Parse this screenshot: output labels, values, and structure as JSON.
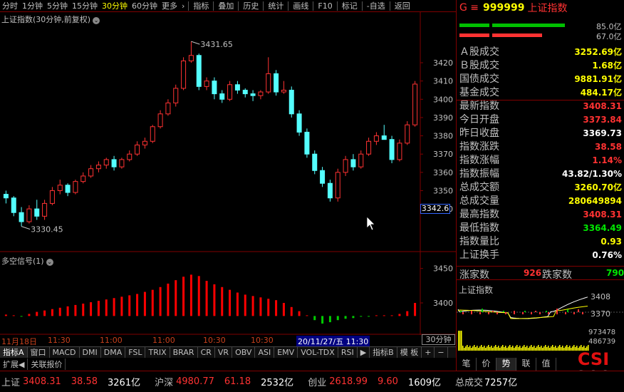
{
  "toolbar": {
    "timeframes": [
      "分时",
      "1分钟",
      "5分钟",
      "15分钟",
      "30分钟",
      "60分钟",
      "更多"
    ],
    "selected_timeframe": "30分钟",
    "buttons": [
      "指标",
      "叠加",
      "历史",
      "统计",
      "画线",
      "F10",
      "标记",
      "-自选",
      "返回"
    ]
  },
  "chart": {
    "title": "上证指数(30分钟,前复权)",
    "high_label": "3431.65",
    "low_label": "3330.45",
    "price_ticks": [
      "3420",
      "3410",
      "3400",
      "3390",
      "3380",
      "3370",
      "3360",
      "3350",
      "3340"
    ],
    "cursor_price": "3342.6",
    "sub_title": "多空信号(1)",
    "sub_ticks": [
      "3450",
      "3400"
    ],
    "time_labels": [
      "11月18日",
      "11:30",
      "11:00",
      "11:00",
      "10:30",
      "10:30"
    ],
    "time_cursor": "20/11/27/五 11:30",
    "period_label": "30分钟"
  },
  "indicator_tabs": [
    "指标A",
    "窗口",
    "MACD",
    "DMI",
    "DMA",
    "FSL",
    "TRIX",
    "BRAR",
    "CR",
    "VR",
    "OBV",
    "ASI",
    "EMV",
    "VOL-TDX",
    "RSI",
    "▶",
    "指标B",
    "模 板",
    "+",
    "−"
  ],
  "ext_tabs": [
    "扩展◀",
    "关联报价"
  ],
  "chart_data": {
    "type": "candlestick",
    "title": "上证指数(30分钟,前复权)",
    "ylim": [
      3326,
      3436
    ],
    "ohlc_approx": [
      [
        3348,
        3350,
        3343,
        3346
      ],
      [
        3346,
        3347,
        3336,
        3338
      ],
      [
        3338,
        3341,
        3330.45,
        3333
      ],
      [
        3333,
        3342,
        3332,
        3340
      ],
      [
        3340,
        3345,
        3334,
        3336
      ],
      [
        3336,
        3345,
        3334,
        3343
      ],
      [
        3343,
        3352,
        3342,
        3350
      ],
      [
        3350,
        3356,
        3348,
        3353
      ],
      [
        3353,
        3354,
        3347,
        3349
      ],
      [
        3349,
        3356,
        3348,
        3355
      ],
      [
        3355,
        3360,
        3354,
        3358
      ],
      [
        3358,
        3364,
        3357,
        3362
      ],
      [
        3362,
        3366,
        3360,
        3364
      ],
      [
        3364,
        3368,
        3362,
        3367
      ],
      [
        3367,
        3369,
        3361,
        3363
      ],
      [
        3363,
        3368,
        3362,
        3367
      ],
      [
        3367,
        3372,
        3366,
        3370
      ],
      [
        3370,
        3377,
        3369,
        3375
      ],
      [
        3375,
        3379,
        3373,
        3377
      ],
      [
        3377,
        3386,
        3376,
        3385
      ],
      [
        3385,
        3394,
        3384,
        3392
      ],
      [
        3392,
        3400,
        3391,
        3398
      ],
      [
        3398,
        3408,
        3396,
        3406
      ],
      [
        3406,
        3423,
        3405,
        3421
      ],
      [
        3421,
        3431.65,
        3420,
        3424
      ],
      [
        3424,
        3425,
        3405,
        3407
      ],
      [
        3407,
        3412,
        3405,
        3410
      ],
      [
        3410,
        3412,
        3400,
        3403
      ],
      [
        3403,
        3405,
        3398,
        3400
      ],
      [
        3400,
        3410,
        3399,
        3408
      ],
      [
        3408,
        3410,
        3403,
        3405
      ],
      [
        3405,
        3406,
        3401,
        3403
      ],
      [
        3403,
        3405,
        3399,
        3402
      ],
      [
        3402,
        3405,
        3400,
        3404
      ],
      [
        3404,
        3423,
        3403,
        3414
      ],
      [
        3414,
        3416,
        3402,
        3404
      ],
      [
        3404,
        3410,
        3403,
        3405
      ],
      [
        3405,
        3407,
        3390,
        3392
      ],
      [
        3392,
        3394,
        3380,
        3382
      ],
      [
        3382,
        3384,
        3368,
        3370
      ],
      [
        3370,
        3372,
        3359,
        3361
      ],
      [
        3361,
        3363,
        3352,
        3354
      ],
      [
        3354,
        3356,
        3344,
        3346
      ],
      [
        3346,
        3362,
        3344,
        3360
      ],
      [
        3360,
        3369,
        3358,
        3367
      ],
      [
        3367,
        3370,
        3361,
        3363
      ],
      [
        3363,
        3372,
        3362,
        3370
      ],
      [
        3370,
        3379,
        3369,
        3377
      ],
      [
        3377,
        3382,
        3375,
        3380
      ],
      [
        3380,
        3386,
        3378,
        3378
      ],
      [
        3378,
        3380,
        3365,
        3367
      ],
      [
        3367,
        3378,
        3366,
        3376
      ],
      [
        3376,
        3388,
        3375,
        3386
      ],
      [
        3386,
        3410,
        3385,
        3408.31
      ]
    ],
    "signal": {
      "name": "多空信号(1)",
      "ylim": [
        3370,
        3460
      ],
      "values": [
        3383,
        3382,
        3381,
        3384,
        3387,
        3389,
        3391,
        3393,
        3395,
        3397,
        3399,
        3401,
        3403,
        3405,
        3407,
        3409,
        3411,
        3413,
        3416,
        3419,
        3423,
        3428,
        3433,
        3438,
        3441,
        3439,
        3432,
        3427,
        3423,
        3419,
        3415,
        3412,
        3410,
        3408,
        3406,
        3404,
        3400,
        3394,
        3388,
        3382,
        3375,
        3370,
        3372,
        3375,
        3377,
        3378,
        3380,
        3381,
        3382,
        3382,
        3382,
        3384,
        3388,
        3400
      ],
      "colors_note": "red above zero, green below zero"
    },
    "xlabel": "",
    "ylabel": ""
  },
  "right_panel": {
    "code_prefix": "G ≡",
    "code": "999999",
    "name": "上证指数",
    "vol_bar_top_value": "85.0亿",
    "vol_bar_bottom_value": "67.0亿",
    "stats": [
      {
        "k": "Ａ股成交",
        "v": "3252.69亿",
        "c": "yellow"
      },
      {
        "k": "Ｂ股成交",
        "v": "1.68亿",
        "c": "yellow"
      },
      {
        "k": "国债成交",
        "v": "9881.91亿",
        "c": "yellow"
      },
      {
        "k": "基金成交",
        "v": "484.17亿",
        "c": "yellow"
      },
      {
        "k": "最新指数",
        "v": "3408.31",
        "c": "red"
      },
      {
        "k": "今日开盘",
        "v": "3373.84",
        "c": "red"
      },
      {
        "k": "昨日收盘",
        "v": "3369.73",
        "c": "white"
      },
      {
        "k": "指数涨跌",
        "v": "38.58",
        "c": "red"
      },
      {
        "k": "指数涨幅",
        "v": "1.14%",
        "c": "red"
      },
      {
        "k": "指数振幅",
        "v": "43.82/1.30%",
        "c": "white"
      },
      {
        "k": "总成交额",
        "v": "3260.70亿",
        "c": "yellow"
      },
      {
        "k": "总成交量",
        "v": "280649894",
        "c": "yellow"
      },
      {
        "k": "最高指数",
        "v": "3408.31",
        "c": "red"
      },
      {
        "k": "最低指数",
        "v": "3364.49",
        "c": "green"
      },
      {
        "k": "指数量比",
        "v": "0.93",
        "c": "yellow"
      },
      {
        "k": "上证换手",
        "v": "0.76%",
        "c": "white"
      }
    ],
    "up_label": "涨家数",
    "up_value": "926",
    "down_label": "跌家数",
    "down_value": "790",
    "mini_title": "上证指数",
    "mini_high": "3408",
    "mini_prev": "3370",
    "mini_vol_high": "973478",
    "mini_vol_low": "486739",
    "mini_tabs": [
      "笔",
      "价",
      "势",
      "联",
      "值"
    ],
    "selected_mini_tab": "势",
    "logo_text_top": "CSI",
    "logo_text_bottom": "300"
  },
  "ticker": [
    {
      "name": "上证",
      "price": "3408.31",
      "chg": "38.58",
      "amt": "3261亿"
    },
    {
      "name": "沪深",
      "price": "4980.77",
      "chg": "61.18",
      "amt": "2532亿"
    },
    {
      "name": "创业",
      "price": "2618.99",
      "chg": "9.60",
      "amt": "1609亿"
    }
  ],
  "ticker_total_label": "总成交",
  "ticker_total_value": "7257亿",
  "colors": {
    "up": "#ff3232",
    "down": "#54ffff",
    "signal_up": "#ff0000",
    "signal_down": "#00cc00",
    "border": "#800000",
    "axis_text": "#c0c0c0"
  }
}
